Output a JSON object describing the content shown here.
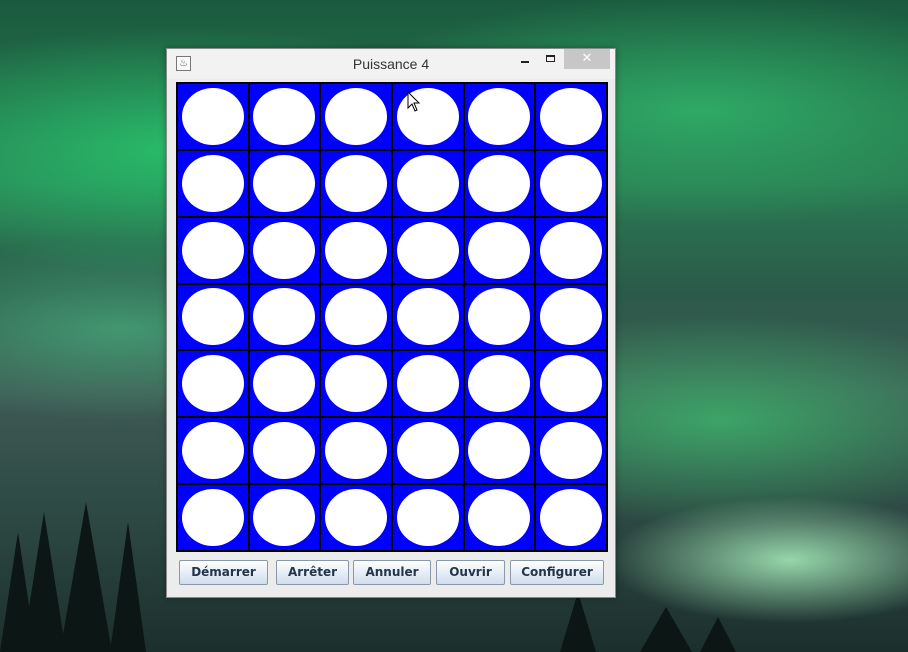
{
  "window": {
    "title": "Puissance 4",
    "close_glyph": "✕",
    "app_icon": "java-icon"
  },
  "board": {
    "rows": 7,
    "columns": 6,
    "frame_color": "#0000ff",
    "grid_color": "#000000",
    "empty_disc_color": "#ffffff",
    "cells": [
      [
        "empty",
        "empty",
        "empty",
        "empty",
        "empty",
        "empty"
      ],
      [
        "empty",
        "empty",
        "empty",
        "empty",
        "empty",
        "empty"
      ],
      [
        "empty",
        "empty",
        "empty",
        "empty",
        "empty",
        "empty"
      ],
      [
        "empty",
        "empty",
        "empty",
        "empty",
        "empty",
        "empty"
      ],
      [
        "empty",
        "empty",
        "empty",
        "empty",
        "empty",
        "empty"
      ],
      [
        "empty",
        "empty",
        "empty",
        "empty",
        "empty",
        "empty"
      ],
      [
        "empty",
        "empty",
        "empty",
        "empty",
        "empty",
        "empty"
      ]
    ]
  },
  "buttons": {
    "start": "Démarrer",
    "stop": "Arrêter",
    "cancel": "Annuler",
    "open": "Ouvrir",
    "configure": "Configurer"
  }
}
